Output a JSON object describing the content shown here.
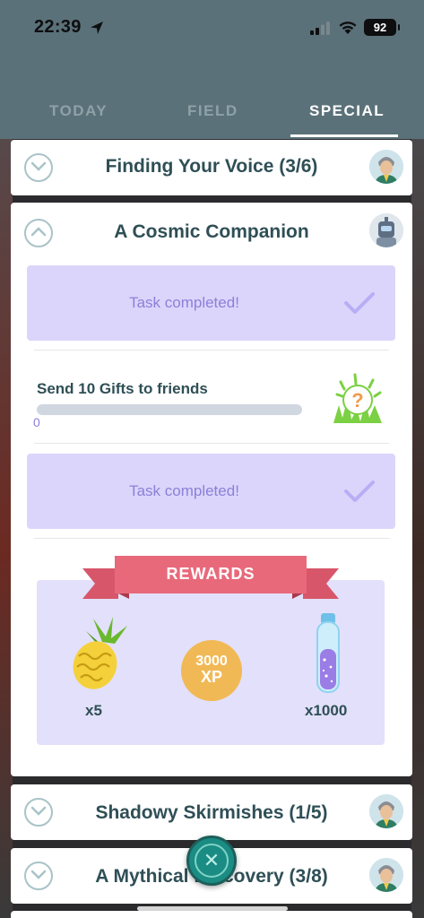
{
  "status_bar": {
    "time": "22:39",
    "battery": "92"
  },
  "tabs": [
    {
      "label": "TODAY",
      "active": false
    },
    {
      "label": "FIELD",
      "active": false
    },
    {
      "label": "SPECIAL",
      "active": true
    }
  ],
  "quests": [
    {
      "title": "Finding Your Voice (3/6)",
      "expanded": false,
      "avatar_icon": "trainer-avatar-icon"
    },
    {
      "title": "A Cosmic Companion",
      "expanded": true,
      "avatar_icon": "robot-avatar-icon",
      "tasks": [
        {
          "status": "Task completed!",
          "completed": true
        },
        {
          "text": "Send 10 Gifts to friends",
          "progress": 0,
          "progress_label": "0",
          "completed": false,
          "reward_icon": "mystery-encounter-icon"
        },
        {
          "status": "Task completed!",
          "completed": true
        }
      ],
      "rewards": {
        "title": "REWARDS",
        "items": [
          {
            "icon": "golden-pinap-berry-icon",
            "quantity": "x5"
          },
          {
            "icon": "xp-coin-icon",
            "amount": "3000",
            "unit": "XP"
          },
          {
            "icon": "stardust-vial-icon",
            "quantity": "x1000"
          }
        ]
      }
    },
    {
      "title": "Shadowy Skirmishes (1/5)",
      "expanded": false,
      "avatar_icon": "trainer-avatar-icon"
    },
    {
      "title": "A Mythical Discovery (3/8)",
      "expanded": false,
      "avatar_icon": "trainer-avatar-icon"
    }
  ],
  "colors": {
    "header": "#5b7179",
    "accent_purple": "#8b80d8",
    "completed_bg": "#dcd5fb",
    "ribbon": "#e8697a",
    "fab": "#1a8c84"
  }
}
